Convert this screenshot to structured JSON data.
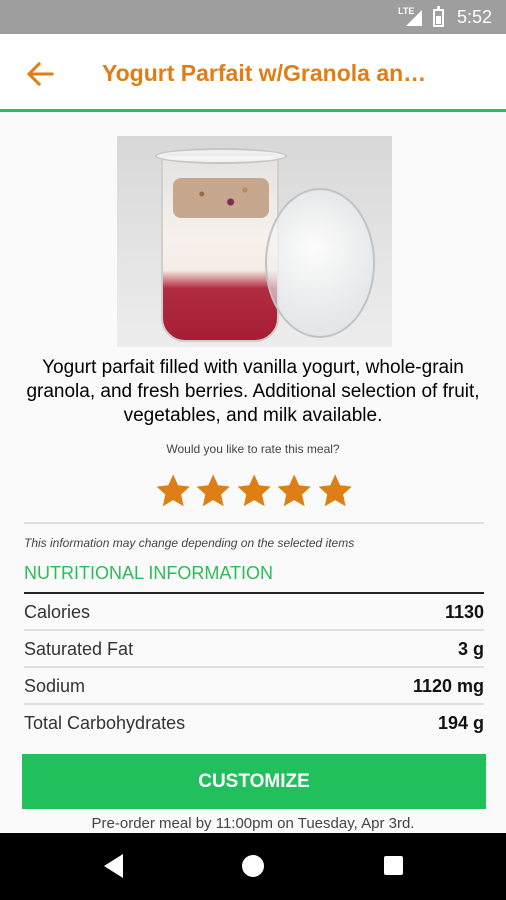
{
  "status_bar": {
    "network": "LTE",
    "time": "5:52"
  },
  "header": {
    "title": "Yogurt Parfait w/Granola an…",
    "accent_color": "#de7f16",
    "underline_color": "#2bbd57",
    "back_icon": "arrow-left-icon"
  },
  "meal": {
    "image_alt": "yogurt-parfait-cup-image",
    "description": "Yogurt parfait filled with vanilla yogurt, whole-grain granola, and fresh berries. Additional selection of fruit, vegetables, and milk available."
  },
  "rating": {
    "prompt": "Would you like to rate this meal?",
    "star_count": 5,
    "star_color": "#de7f16"
  },
  "nutrition": {
    "disclaimer": "This information may change depending on the selected items",
    "title": "NUTRITIONAL INFORMATION",
    "rows": [
      {
        "name": "Calories",
        "value": "1130"
      },
      {
        "name": "Saturated Fat",
        "value": "3 g"
      },
      {
        "name": "Sodium",
        "value": "1120 mg"
      },
      {
        "name": "Total Carbohydrates",
        "value": "194 g"
      }
    ]
  },
  "actions": {
    "customize_label": "CUSTOMIZE",
    "customize_color": "#21c05c",
    "preorder_text": "Pre-order meal by 11:00pm on Tuesday, Apr 3rd."
  }
}
